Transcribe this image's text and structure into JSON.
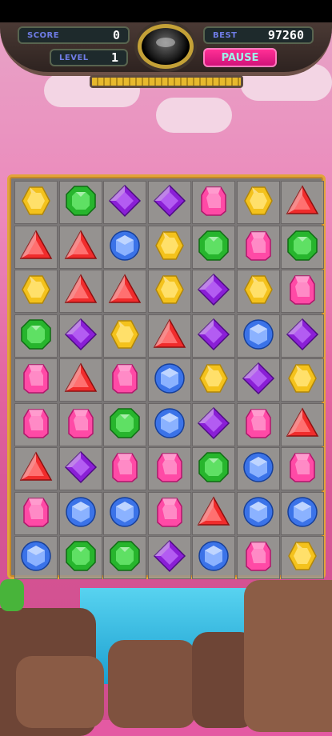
{
  "hud": {
    "score_label": "SCORE",
    "score_value": "0",
    "best_label": "BEST",
    "best_value": "97260",
    "level_label": "LEVEL",
    "level_value": "1",
    "pause_label": "PAUSE",
    "progress_fraction": 1.0
  },
  "colors": {
    "yellow": "#f4c21c",
    "green": "#27b52d",
    "purple": "#8a1fd6",
    "pink": "#ff4aa6",
    "red": "#f02c2c",
    "blue": "#3b73e8"
  },
  "board": [
    [
      "yellow",
      "green",
      "purple",
      "purple",
      "pink",
      "yellow",
      "red"
    ],
    [
      "red",
      "red",
      "blue",
      "yellow",
      "green",
      "pink",
      "green"
    ],
    [
      "yellow",
      "red",
      "red",
      "yellow",
      "purple",
      "yellow",
      "pink"
    ],
    [
      "green",
      "purple",
      "yellow",
      "red",
      "purple",
      "blue",
      "purple"
    ],
    [
      "pink",
      "red",
      "pink",
      "blue",
      "yellow",
      "purple",
      "yellow"
    ],
    [
      "pink",
      "pink",
      "green",
      "blue",
      "purple",
      "pink",
      "red"
    ],
    [
      "red",
      "purple",
      "pink",
      "pink",
      "green",
      "blue",
      "pink"
    ],
    [
      "pink",
      "blue",
      "blue",
      "pink",
      "red",
      "blue",
      "blue"
    ],
    [
      "blue",
      "green",
      "green",
      "purple",
      "blue",
      "pink",
      "yellow"
    ]
  ]
}
